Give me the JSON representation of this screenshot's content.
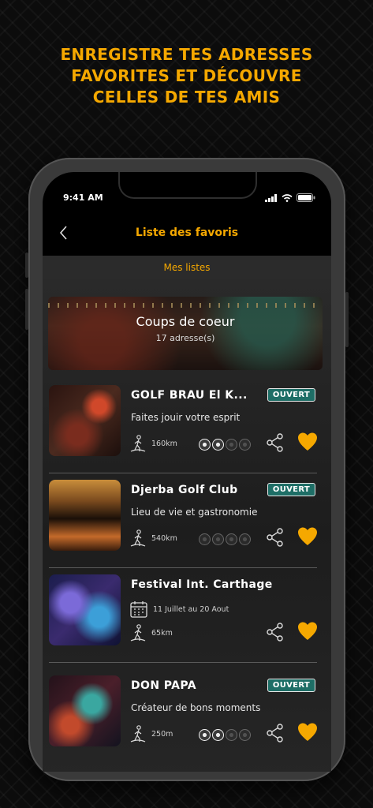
{
  "promo": {
    "line1": "ENREGISTRE TES ADRESSES",
    "line2": "FAVORITES ET DÉCOUVRE",
    "line3": "CELLES DE TES AMIS"
  },
  "status_bar": {
    "time": "9:41 AM"
  },
  "header": {
    "title": "Liste des favoris",
    "back_icon": "chevron-left-icon"
  },
  "tabs": {
    "active_label": "Mes listes"
  },
  "banner": {
    "title": "Coups de coeur",
    "count": "17 adresse(s)"
  },
  "colors": {
    "accent": "#f5a800",
    "badge_bg": "#1e6e66"
  },
  "cards": [
    {
      "title": "GOLF BRAU El K...",
      "badge": "OUVERT",
      "subtitle": "Faites jouir votre esprit",
      "distance": "160km",
      "rating": 2,
      "rating_max": 4
    },
    {
      "title": "Djerba Golf Club",
      "badge": "OUVERT",
      "subtitle": "Lieu de vie et gastronomie",
      "distance": "540km",
      "rating": 0,
      "rating_max": 4
    },
    {
      "title": "Festival Int. Carthage",
      "date": "11 Juillet au 20 Aout",
      "distance": "65km"
    },
    {
      "title": "DON PAPA",
      "badge": "OUVERT",
      "subtitle": "Créateur de bons moments",
      "distance": "250m",
      "rating": 2,
      "rating_max": 4
    }
  ]
}
